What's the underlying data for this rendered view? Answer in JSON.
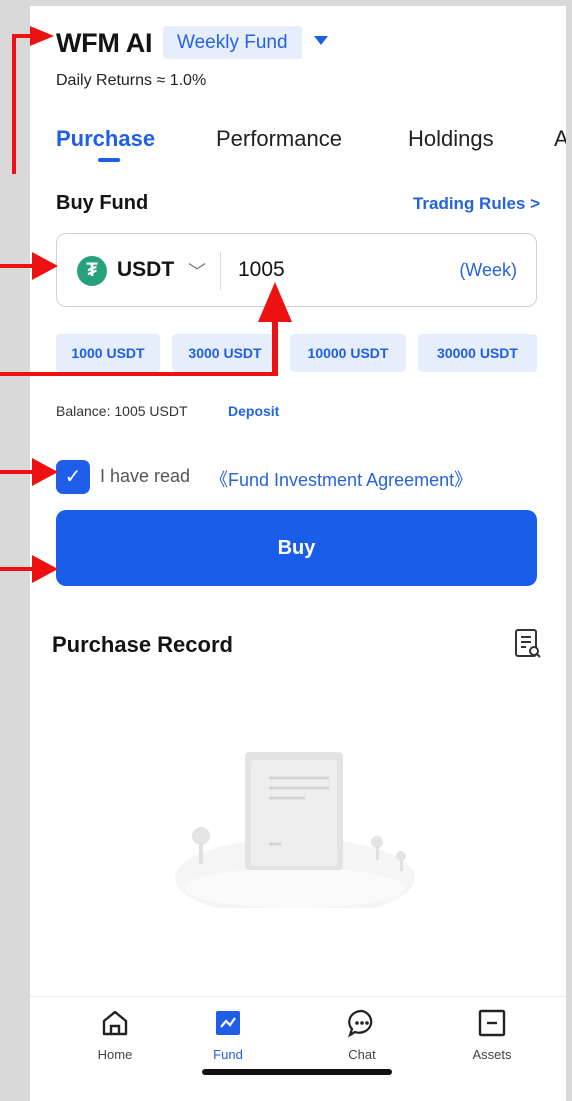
{
  "header": {
    "title": "WFM AI",
    "fund_selector": "Weekly Fund",
    "daily_returns": "Daily Returns ≈ 1.0%"
  },
  "tabs": [
    {
      "label": "Purchase",
      "active": true
    },
    {
      "label": "Performance",
      "active": false
    },
    {
      "label": "Holdings",
      "active": false
    },
    {
      "label": "A",
      "active": false
    }
  ],
  "buy_fund": {
    "title": "Buy Fund",
    "trading_rules": "Trading Rules >",
    "currency": "USDT",
    "currency_icon": "tether-icon",
    "amount": "1005",
    "period": "(Week)",
    "quick_amounts": [
      "1000 USDT",
      "3000 USDT",
      "10000 USDT",
      "30000 USDT"
    ],
    "balance": "Balance: 1005 USDT",
    "deposit": "Deposit",
    "agreement_prefix": "I have read",
    "agreement_link": "《Fund Investment Agreement》",
    "agreement_checked": true,
    "buy_label": "Buy"
  },
  "purchase_record": {
    "title": "Purchase Record",
    "icon": "record-search-icon"
  },
  "bottom_nav": [
    {
      "label": "Home",
      "icon": "home-icon",
      "active": false
    },
    {
      "label": "Fund",
      "icon": "fund-chart-icon",
      "active": true
    },
    {
      "label": "Chat",
      "icon": "chat-bubble-icon",
      "active": false
    },
    {
      "label": "Assets",
      "icon": "assets-box-icon",
      "active": false
    }
  ],
  "colors": {
    "accent": "#1e5ee8",
    "chip_bg": "#e6eefc",
    "annotation": "#ee1111",
    "tether": "#26a17b"
  }
}
